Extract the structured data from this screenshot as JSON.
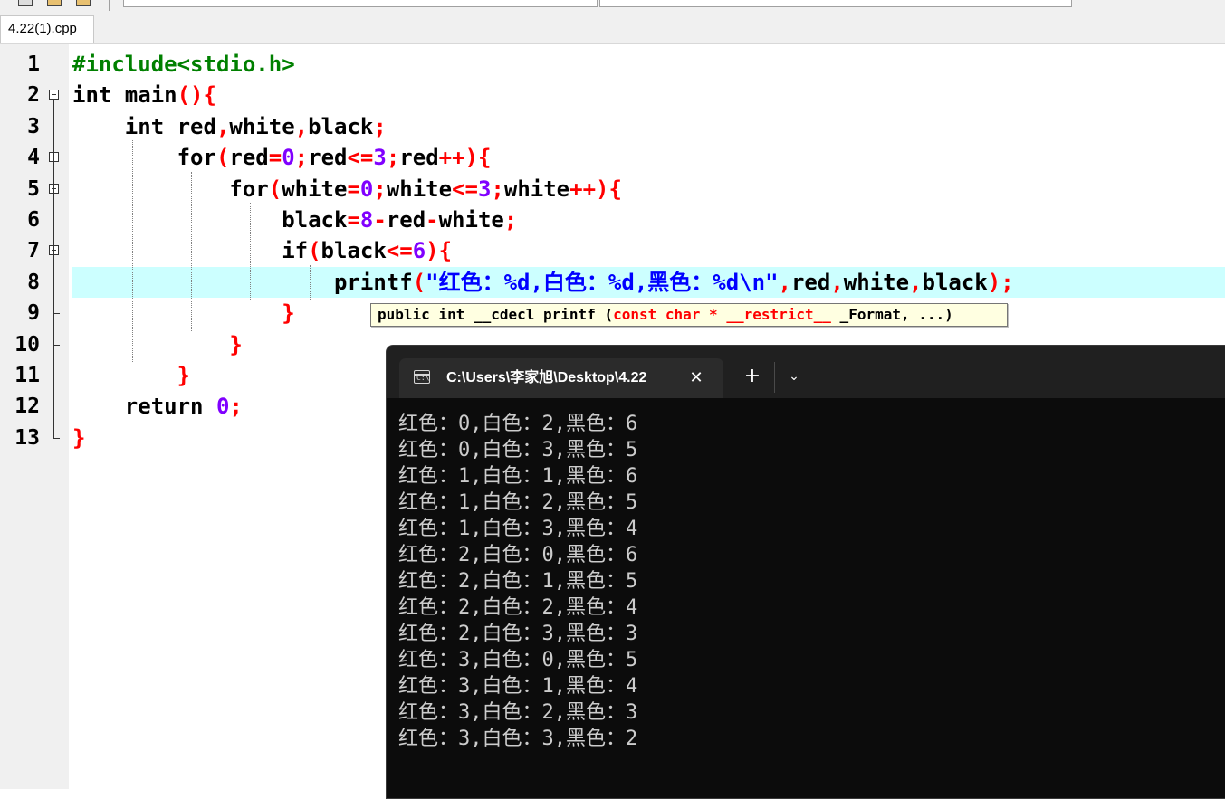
{
  "tab": {
    "filename": "4.22(1).cpp"
  },
  "editor": {
    "line_numbers": [
      "1",
      "2",
      "3",
      "4",
      "5",
      "6",
      "7",
      "8",
      "9",
      "10",
      "11",
      "12",
      "13"
    ],
    "lines": [
      [
        [
          "pre",
          "#include<stdio.h>"
        ]
      ],
      [
        [
          "kw",
          "int "
        ],
        [
          "id",
          "main"
        ],
        [
          "op",
          "(){"
        ]
      ],
      [
        [
          "id",
          "    "
        ],
        [
          "kw",
          "int "
        ],
        [
          "id",
          "red"
        ],
        [
          "op",
          ","
        ],
        [
          "id",
          "white"
        ],
        [
          "op",
          ","
        ],
        [
          "id",
          "black"
        ],
        [
          "op",
          ";"
        ]
      ],
      [
        [
          "id",
          "        "
        ],
        [
          "kw",
          "for"
        ],
        [
          "op",
          "("
        ],
        [
          "id",
          "red"
        ],
        [
          "op",
          "="
        ],
        [
          "num",
          "0"
        ],
        [
          "op",
          ";"
        ],
        [
          "id",
          "red"
        ],
        [
          "op",
          "<="
        ],
        [
          "num",
          "3"
        ],
        [
          "op",
          ";"
        ],
        [
          "id",
          "red"
        ],
        [
          "op",
          "++){"
        ]
      ],
      [
        [
          "id",
          "            "
        ],
        [
          "kw",
          "for"
        ],
        [
          "op",
          "("
        ],
        [
          "id",
          "white"
        ],
        [
          "op",
          "="
        ],
        [
          "num",
          "0"
        ],
        [
          "op",
          ";"
        ],
        [
          "id",
          "white"
        ],
        [
          "op",
          "<="
        ],
        [
          "num",
          "3"
        ],
        [
          "op",
          ";"
        ],
        [
          "id",
          "white"
        ],
        [
          "op",
          "++){"
        ]
      ],
      [
        [
          "id",
          "                "
        ],
        [
          "id",
          "black"
        ],
        [
          "op",
          "="
        ],
        [
          "num",
          "8"
        ],
        [
          "op",
          "-"
        ],
        [
          "id",
          "red"
        ],
        [
          "op",
          "-"
        ],
        [
          "id",
          "white"
        ],
        [
          "op",
          ";"
        ]
      ],
      [
        [
          "id",
          "                "
        ],
        [
          "kw",
          "if"
        ],
        [
          "op",
          "("
        ],
        [
          "id",
          "black"
        ],
        [
          "op",
          "<="
        ],
        [
          "num",
          "6"
        ],
        [
          "op",
          ")"
        ],
        [
          "op",
          "{"
        ]
      ],
      [
        [
          "id",
          "                    "
        ],
        [
          "id",
          "printf"
        ],
        [
          "op",
          "("
        ],
        [
          "str",
          "\"红色：%d,白色：%d,黑色：%d\\n\""
        ],
        [
          "op",
          ","
        ],
        [
          "id",
          "red"
        ],
        [
          "op",
          ","
        ],
        [
          "id",
          "white"
        ],
        [
          "op",
          ","
        ],
        [
          "id",
          "black"
        ],
        [
          "op",
          ");"
        ]
      ],
      [
        [
          "id",
          "                "
        ],
        [
          "op",
          "}"
        ]
      ],
      [
        [
          "id",
          "            "
        ],
        [
          "op",
          "}"
        ]
      ],
      [
        [
          "id",
          "        "
        ],
        [
          "op",
          "}"
        ]
      ],
      [
        [
          "id",
          "    "
        ],
        [
          "kw",
          "return "
        ],
        [
          "num",
          "0"
        ],
        [
          "op",
          ";"
        ]
      ],
      [
        [
          "op",
          "}"
        ]
      ]
    ]
  },
  "calltip": {
    "prefix": "public int __cdecl printf (",
    "keywords": "const char * __restrict__",
    "suffix": " _Format, ...)"
  },
  "terminal": {
    "tab_title": "C:\\Users\\李家旭\\Desktop\\4.22",
    "tab_icon": "terminal-icon",
    "close_glyph": "✕",
    "new_tab_glyph": "+",
    "dropdown_glyph": "⌄",
    "output": [
      "红色：0,白色：2,黑色：6",
      "红色：0,白色：3,黑色：5",
      "红色：1,白色：1,黑色：6",
      "红色：1,白色：2,黑色：5",
      "红色：1,白色：3,黑色：4",
      "红色：2,白色：0,黑色：6",
      "红色：2,白色：1,黑色：5",
      "红色：2,白色：2,黑色：4",
      "红色：2,白色：3,黑色：3",
      "红色：3,白色：0,黑色：5",
      "红色：3,白色：1,黑色：4",
      "红色：3,白色：2,黑色：3",
      "红色：3,白色：3,黑色：2"
    ]
  },
  "colors": {
    "keyword": "#000000",
    "preprocessor": "#008000",
    "number": "#8000ff",
    "operator": "#ff0000",
    "string": "#0000ff",
    "current_line": "#ccffff",
    "terminal_bg": "#0c0c0c",
    "terminal_text": "#cccccc"
  }
}
